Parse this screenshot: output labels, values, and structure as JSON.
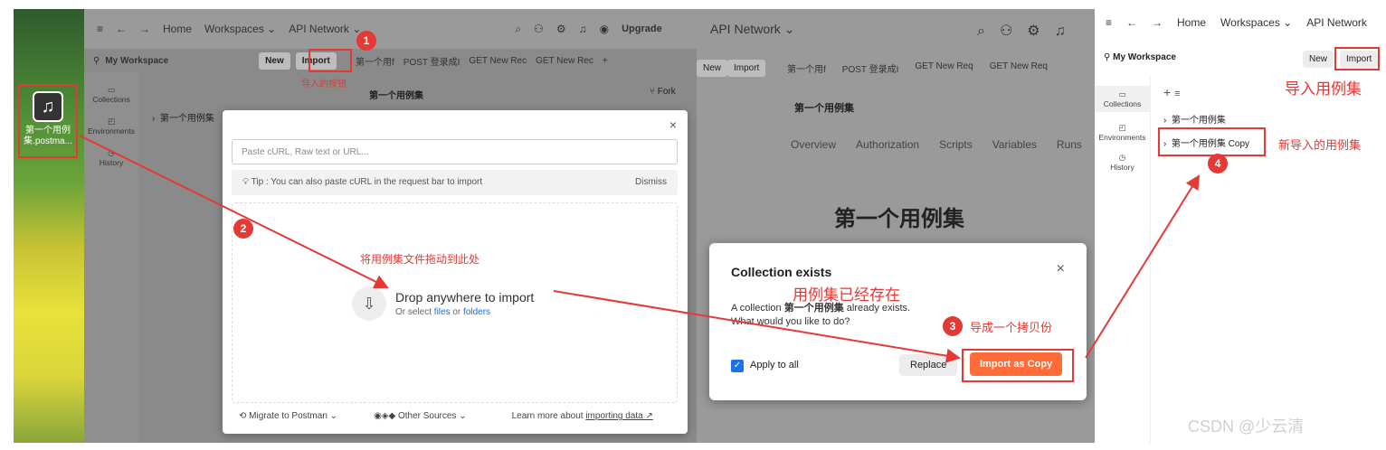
{
  "desktop": {
    "file_label": "第一个用例集.postma..."
  },
  "pm1": {
    "nav": {
      "home": "Home",
      "workspaces": "Workspaces ⌄",
      "api_network": "API Network ⌄",
      "upgrade": "Upgrade"
    },
    "workspace": "My Workspace",
    "new_btn": "New",
    "import_btn": "Import",
    "tabs": [
      "第一个用f",
      "POST 登录成I",
      "GET New Rec",
      "GET New Rec"
    ],
    "sidebar": [
      "Collections",
      "Environments",
      "History"
    ],
    "tree_item": "第一个用例集",
    "header_title": "第一个用例集",
    "fork": "Fork"
  },
  "import_modal": {
    "paste_placeholder": "Paste cURL, Raw text or URL...",
    "tip": "Tip : You can also paste cURL in the request bar to import",
    "dismiss": "Dismiss",
    "drop_title": "Drop anywhere to import",
    "drop_sub_prefix": "Or select ",
    "files": "files",
    "or": " or ",
    "folders": "folders",
    "migrate": "Migrate to Postman",
    "other_sources": "Other Sources",
    "learn_prefix": "Learn more about ",
    "learn_link": "importing data ↗"
  },
  "pm2": {
    "api_network": "API Network ⌄",
    "btn_new": "New",
    "btn_import": "Import",
    "tabs": [
      "第一个用f",
      "POST 登录成I",
      "GET New Req",
      "GET New Req"
    ],
    "title": "第一个用例集",
    "subtabs": [
      "Overview",
      "Authorization",
      "Scripts",
      "Variables",
      "Runs"
    ],
    "big_title": "第一个用例集"
  },
  "dialog": {
    "title": "Collection exists",
    "body_prefix": "A collection ",
    "body_name": "第一个用例集",
    "body_suffix": " already exists.",
    "question": "What would you like to do?",
    "apply_all": "Apply to all",
    "replace": "Replace",
    "import_copy": "Import as Copy"
  },
  "pm3": {
    "home": "Home",
    "workspaces": "Workspaces ⌄",
    "api_network": "API Network",
    "workspace": "My Workspace",
    "new_btn": "New",
    "import_btn": "Import",
    "sidebar": [
      "Collections",
      "Environments",
      "History"
    ],
    "tree": [
      "第一个用例集",
      "第一个用例集 Copy"
    ]
  },
  "annotations": {
    "a1": "导入的按钮",
    "a2": "将用例集文件拖动到此处",
    "a3": "用例集已经存在",
    "a4": "导成一个拷贝份",
    "a5": "导入用例集",
    "a6": "新导入的用例集",
    "n1": "1",
    "n2": "2",
    "n3": "3",
    "n4": "4"
  },
  "watermark": "CSDN @少云清",
  "colors": {
    "accent": "#ff6c37",
    "annotation": "#e53935",
    "link": "#0d6efd"
  }
}
